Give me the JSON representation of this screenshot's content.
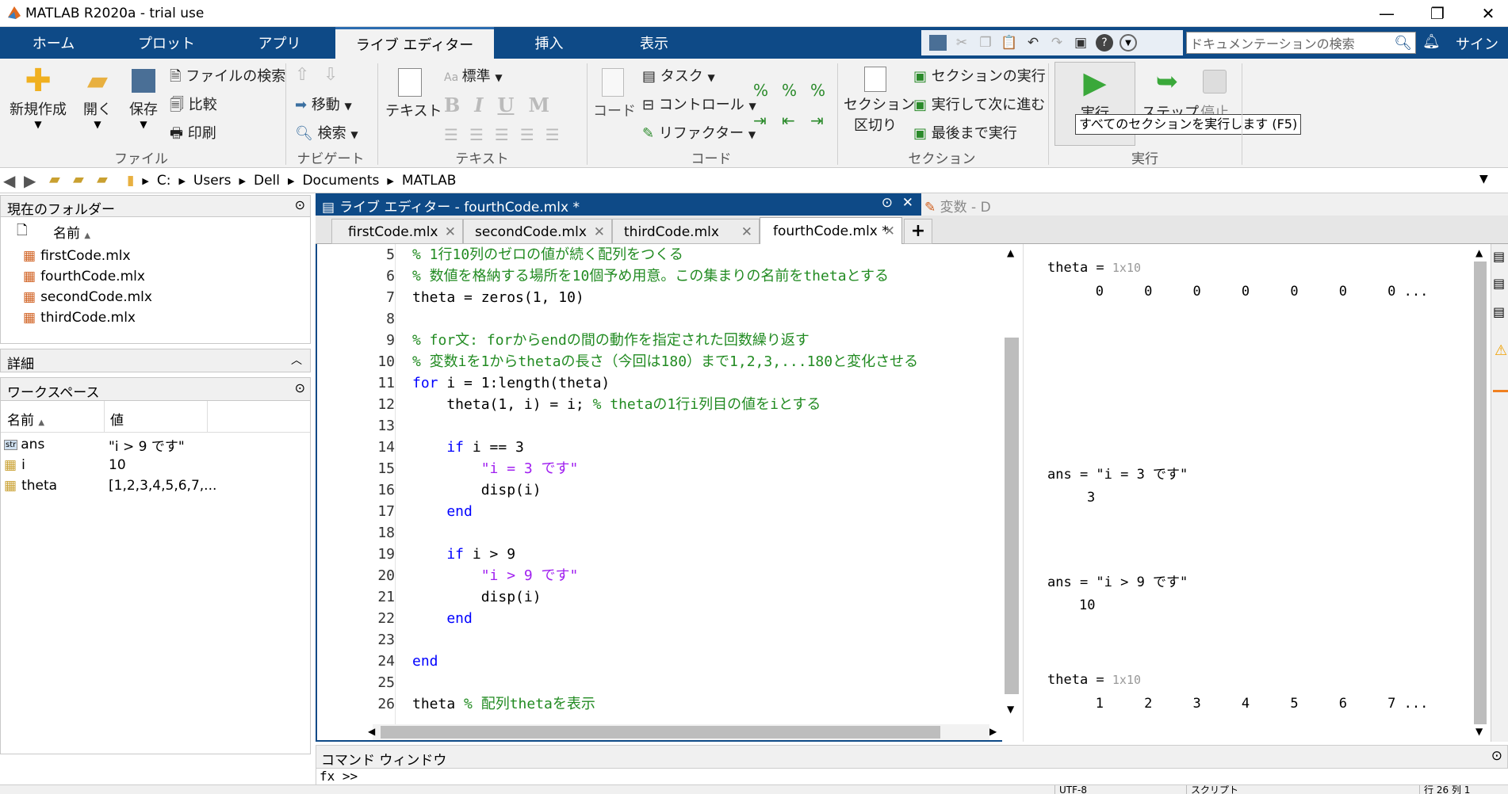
{
  "window": {
    "title": "MATLAB R2020a - trial use",
    "minimize": "—",
    "restore": "❐",
    "close": "✕"
  },
  "tabs": [
    "ホーム",
    "プロット",
    "アプリ",
    "ライブ エディター",
    "挿入",
    "表示"
  ],
  "search": {
    "placeholder": "ドキュメンテーションの検索",
    "signin": "サインイン"
  },
  "ribbon": {
    "file": {
      "new": "新規作成",
      "open": "開く",
      "save": "保存",
      "find": "ファイルの検索",
      "compare": "比較",
      "print": "印刷",
      "group": "ファイル"
    },
    "nav": {
      "goto": "移動",
      "find": "検索",
      "group": "ナビゲート"
    },
    "text": {
      "text": "テキスト",
      "style": "標準",
      "bold": "B",
      "italic": "I",
      "underline": "U",
      "mono": "M",
      "group": "テキスト"
    },
    "code": {
      "code": "コード",
      "task": "タスク",
      "control": "コントロール",
      "refactor": "リファクター",
      "group": "コード"
    },
    "section": {
      "break1": "セクション",
      "break2": "区切り",
      "run_section": "セクションの実行",
      "run_advance": "実行して次に進む",
      "run_end": "最後まで実行",
      "group": "セクション"
    },
    "run": {
      "run": "実行",
      "step": "ステップ",
      "stop": "停止",
      "group": "実行",
      "tooltip": "すべてのセクションを実行します (F5)"
    }
  },
  "address": [
    "C:",
    "Users",
    "Dell",
    "Documents",
    "MATLAB"
  ],
  "folder": {
    "title": "現在のフォルダー",
    "col_name": "名前",
    "files": [
      "firstCode.mlx",
      "fourthCode.mlx",
      "secondCode.mlx",
      "thirdCode.mlx"
    ]
  },
  "details": {
    "title": "詳細"
  },
  "workspace": {
    "title": "ワークスペース",
    "col_name": "名前",
    "col_value": "値",
    "vars": [
      {
        "name": "ans",
        "value": "\"i > 9 です\"",
        "icon": "str"
      },
      {
        "name": "i",
        "value": "10",
        "icon": "grid"
      },
      {
        "name": "theta",
        "value": "[1,2,3,4,5,6,7,...",
        "icon": "grid"
      }
    ]
  },
  "editor": {
    "title": "ライブ エディター - fourthCode.mlx *",
    "var_tab": "変数 - D",
    "tabs": [
      "firstCode.mlx",
      "secondCode.mlx",
      "thirdCode.mlx",
      "fourthCode.mlx *"
    ],
    "line_numbers": [
      "5",
      "6",
      "7",
      "8",
      "9",
      "10",
      "11",
      "12",
      "13",
      "14",
      "15",
      "16",
      "17",
      "18",
      "19",
      "20",
      "21",
      "22",
      "23",
      "24",
      "25",
      "26"
    ],
    "lines": [
      [
        [
          "cm",
          "% 1行10列のゼロの値が続く配列をつくる"
        ]
      ],
      [
        [
          "cm",
          "% 数値を格納する場所を10個予め用意。この集まりの名前をthetaとする"
        ]
      ],
      [
        [
          "",
          "theta = zeros(1, 10)"
        ]
      ],
      [
        [
          "",
          ""
        ]
      ],
      [
        [
          "cm",
          "% for文: forからendの間の動作を指定された回数繰り返す"
        ]
      ],
      [
        [
          "cm",
          "% 変数iを1からthetaの長さ（今回は180）まで1,2,3,...180と変化させる"
        ]
      ],
      [
        [
          "kw",
          "for"
        ],
        [
          "",
          " i = 1:length(theta)"
        ]
      ],
      [
        [
          "",
          "    theta(1, i) = i; "
        ],
        [
          "cm",
          "% thetaの1行i列目の値をiとする"
        ]
      ],
      [
        [
          "",
          ""
        ]
      ],
      [
        [
          "kw",
          "    if"
        ],
        [
          "",
          " i == 3"
        ]
      ],
      [
        [
          "st",
          "        \"i = 3 です\""
        ]
      ],
      [
        [
          "",
          "        disp(i)"
        ]
      ],
      [
        [
          "kw",
          "    end"
        ]
      ],
      [
        [
          "",
          ""
        ]
      ],
      [
        [
          "kw",
          "    if"
        ],
        [
          "",
          " i > 9"
        ]
      ],
      [
        [
          "st",
          "        \"i > 9 です\""
        ]
      ],
      [
        [
          "",
          "        disp(i)"
        ]
      ],
      [
        [
          "kw",
          "    end"
        ]
      ],
      [
        [
          "",
          ""
        ]
      ],
      [
        [
          "kw",
          "end"
        ]
      ],
      [
        [
          "",
          ""
        ]
      ],
      [
        [
          "",
          "theta "
        ],
        [
          "cm",
          "% 配列thetaを表示"
        ]
      ]
    ]
  },
  "output": {
    "theta1_label": "theta = ",
    "theta1_dim": "1x10",
    "theta1_vals": "   0     0     0     0     0     0     0 ...",
    "ans1_label": "ans = \"i = 3 です\"",
    "ans1_val": "3",
    "ans2_label": "ans = \"i > 9 です\"",
    "ans2_val": "10",
    "theta2_label": "theta = ",
    "theta2_dim": "1x10",
    "theta2_vals": "   1     2     3     4     5     6     7 ..."
  },
  "command": {
    "title": "コマンド ウィンドウ"
  },
  "status": {
    "encoding": "UTF-8",
    "type": "スクリプト",
    "pos": "行 26 列 1"
  }
}
